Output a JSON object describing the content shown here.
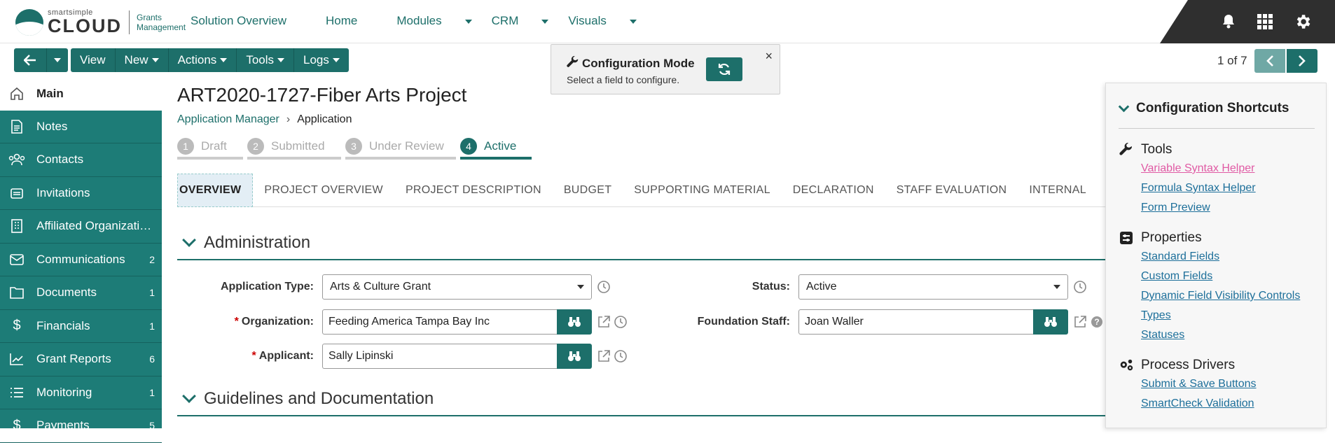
{
  "logo": {
    "small": "smartsimple",
    "big": "CLOUD",
    "product_line1": "Grants",
    "product_line2": "Management"
  },
  "topnav": [
    {
      "label": "Solution Overview",
      "dropdown": false
    },
    {
      "label": "Home",
      "dropdown": false
    },
    {
      "label": "Modules",
      "dropdown": true
    },
    {
      "label": "CRM",
      "dropdown": true
    },
    {
      "label": "Visuals",
      "dropdown": true
    }
  ],
  "toolbar": {
    "view": "View",
    "new": "New",
    "actions": "Actions",
    "tools": "Tools",
    "logs": "Logs"
  },
  "sidebar": [
    {
      "label": "Main",
      "count": "",
      "icon": "home-icon"
    },
    {
      "label": "Notes",
      "count": "",
      "icon": "note-icon"
    },
    {
      "label": "Contacts",
      "count": "",
      "icon": "contacts-icon"
    },
    {
      "label": "Invitations",
      "count": "",
      "icon": "invitation-icon"
    },
    {
      "label": "Affiliated Organizatio...",
      "count": "",
      "icon": "building-icon"
    },
    {
      "label": "Communications",
      "count": "2",
      "icon": "mail-icon"
    },
    {
      "label": "Documents",
      "count": "1",
      "icon": "folder-icon"
    },
    {
      "label": "Financials",
      "count": "1",
      "icon": "dollar-icon"
    },
    {
      "label": "Grant Reports",
      "count": "6",
      "icon": "chart-icon"
    },
    {
      "label": "Monitoring",
      "count": "1",
      "icon": "list-icon"
    },
    {
      "label": "Payments",
      "count": "5",
      "icon": "dollar-icon"
    }
  ],
  "record": {
    "title": "ART2020-1727-Fiber Arts Project"
  },
  "breadcrumb": {
    "parent": "Application Manager",
    "current": "Application"
  },
  "steps": [
    {
      "num": "1",
      "label": "Draft"
    },
    {
      "num": "2",
      "label": "Submitted"
    },
    {
      "num": "3",
      "label": "Under Review"
    },
    {
      "num": "4",
      "label": "Active"
    }
  ],
  "tabs": [
    "OVERVIEW",
    "PROJECT OVERVIEW",
    "PROJECT DESCRIPTION",
    "BUDGET",
    "SUPPORTING MATERIAL",
    "DECLARATION",
    "STAFF EVALUATION",
    "INTERNAL"
  ],
  "sections": {
    "administration": "Administration",
    "guidelines": "Guidelines and Documentation"
  },
  "fields": {
    "application_type": {
      "label": "Application Type:",
      "value": "Arts & Culture Grant"
    },
    "status": {
      "label": "Status:",
      "value": "Active"
    },
    "organization": {
      "label": "Organization:",
      "value": "Feeding America Tampa Bay Inc",
      "required": "*"
    },
    "foundation_staff": {
      "label": "Foundation Staff:",
      "value": "Joan Waller"
    },
    "applicant": {
      "label": "Applicant:",
      "value": "Sally Lipinski",
      "required": "*"
    }
  },
  "config_mode": {
    "title": "Configuration Mode",
    "subtitle": "Select a field to configure.",
    "close": "×"
  },
  "pager": {
    "text": "1 of 7"
  },
  "shortcuts": {
    "title": "Configuration Shortcuts",
    "groups": [
      {
        "title": "Tools",
        "icon": "wrench-icon",
        "links": [
          "Variable Syntax Helper",
          "Formula Syntax Helper",
          "Form Preview"
        ]
      },
      {
        "title": "Properties",
        "icon": "properties-icon",
        "links": [
          "Standard Fields",
          "Custom Fields",
          "Dynamic Field Visibility Controls",
          "Types",
          "Statuses"
        ]
      },
      {
        "title": "Process Drivers",
        "icon": "gears-icon",
        "links": [
          "Submit & Save Buttons",
          "SmartCheck Validation"
        ]
      }
    ]
  },
  "colors": {
    "brand": "#1d6f6a",
    "sidebar": "#1d7c77",
    "link": "#1d6f9a",
    "link_highlight": "#e05aa4"
  }
}
